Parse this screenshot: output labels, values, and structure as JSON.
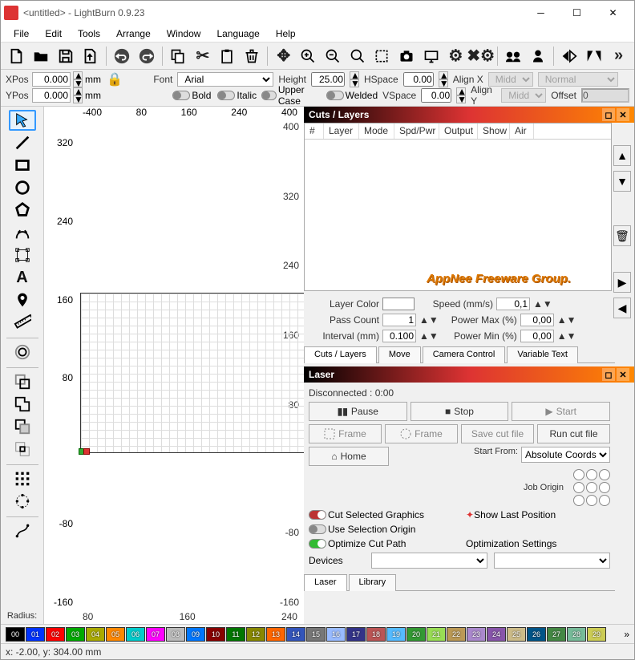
{
  "window": {
    "title": "<untitled> - LightBurn 0.9.23"
  },
  "menu": [
    "File",
    "Edit",
    "Tools",
    "Arrange",
    "Window",
    "Language",
    "Help"
  ],
  "pos": {
    "xlabel": "XPos",
    "xval": "0.000",
    "xunit": "mm",
    "ylabel": "YPos",
    "yval": "0.000",
    "yunit": "mm"
  },
  "font": {
    "label": "Font",
    "family": "Arial",
    "heightLabel": "Height",
    "height": "25.00",
    "hspaceLabel": "HSpace",
    "hspace": "0.00",
    "alignXLabel": "Align X",
    "alignX": "Middle",
    "styleLabel": "Normal",
    "bold": "Bold",
    "italic": "Italic",
    "upper": "Upper Case",
    "welded": "Welded",
    "vspaceLabel": "VSpace",
    "vspace": "0.00",
    "alignYLabel": "Align Y",
    "alignY": "Middle",
    "offsetLabel": "Offset",
    "offset": "0"
  },
  "ruler": {
    "top": [
      "-400",
      "80",
      "160",
      "240",
      "400"
    ],
    "left": [
      "320",
      "240",
      "160",
      "80",
      "-80",
      "-160",
      "80",
      "160",
      "240"
    ]
  },
  "leftRadius": "Radius:",
  "cuts": {
    "title": "Cuts / Layers",
    "cols": [
      "#",
      "Layer",
      "Mode",
      "Spd/Pwr",
      "Output",
      "Show",
      "Air"
    ],
    "watermark": "AppNee Freeware Group.",
    "props": {
      "layerColor": "Layer Color",
      "speed": "Speed (mm/s)",
      "speedVal": "0,1",
      "passCount": "Pass Count",
      "passCountVal": "1",
      "powerMax": "Power Max (%)",
      "powerMaxVal": "0,00",
      "interval": "Interval (mm)",
      "intervalVal": "0.100",
      "powerMin": "Power Min (%)",
      "powerMinVal": "0,00"
    },
    "tabs": [
      "Cuts / Layers",
      "Move",
      "Camera Control",
      "Variable Text"
    ]
  },
  "laser": {
    "title": "Laser",
    "status": "Disconnected : 0:00",
    "pause": "Pause",
    "stop": "Stop",
    "start": "Start",
    "frame1": "Frame",
    "frame2": "Frame",
    "saveCut": "Save cut file",
    "runCut": "Run cut file",
    "home": "Home",
    "startFromLabel": "Start From:",
    "startFrom": "Absolute Coords",
    "jobOrigin": "Job Origin",
    "cutSel": "Cut Selected Graphics",
    "useSel": "Use Selection Origin",
    "showLast": "Show Last Position",
    "optCut": "Optimize Cut Path",
    "optSettings": "Optimization Settings",
    "devices": "Devices",
    "tabs": [
      "Laser",
      "Library"
    ]
  },
  "palette": [
    {
      "n": "00",
      "c": "#000"
    },
    {
      "n": "01",
      "c": "#03f"
    },
    {
      "n": "02",
      "c": "#f00"
    },
    {
      "n": "03",
      "c": "#0a0"
    },
    {
      "n": "04",
      "c": "#aa0"
    },
    {
      "n": "05",
      "c": "#f80"
    },
    {
      "n": "06",
      "c": "#0cc"
    },
    {
      "n": "07",
      "c": "#f0f"
    },
    {
      "n": "08",
      "c": "#bbb"
    },
    {
      "n": "09",
      "c": "#07f"
    },
    {
      "n": "10",
      "c": "#800"
    },
    {
      "n": "11",
      "c": "#070"
    },
    {
      "n": "12",
      "c": "#880"
    },
    {
      "n": "13",
      "c": "#f60"
    },
    {
      "n": "14",
      "c": "#35b"
    },
    {
      "n": "15",
      "c": "#777"
    },
    {
      "n": "16",
      "c": "#9bf"
    },
    {
      "n": "17",
      "c": "#338"
    },
    {
      "n": "18",
      "c": "#b55"
    },
    {
      "n": "19",
      "c": "#5bf"
    },
    {
      "n": "20",
      "c": "#393"
    },
    {
      "n": "21",
      "c": "#9d5"
    },
    {
      "n": "22",
      "c": "#b95"
    },
    {
      "n": "23",
      "c": "#a8c"
    },
    {
      "n": "24",
      "c": "#85a"
    },
    {
      "n": "25",
      "c": "#cb8"
    },
    {
      "n": "26",
      "c": "#058"
    },
    {
      "n": "27",
      "c": "#484"
    },
    {
      "n": "28",
      "c": "#7b9"
    },
    {
      "n": "29",
      "c": "#cc5"
    }
  ],
  "status": "x: -2.00, y: 304.00 mm"
}
